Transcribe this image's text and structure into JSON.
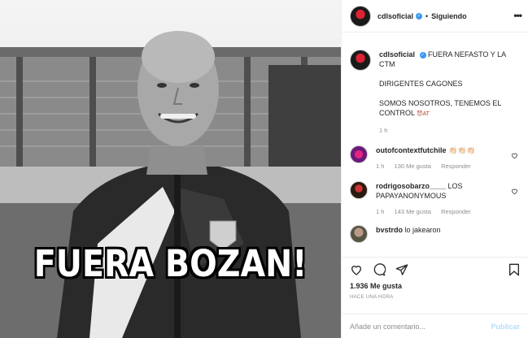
{
  "post": {
    "image_caption": "FUERA BOZAN!"
  },
  "header": {
    "username": "cdlsoficial",
    "separator": "•",
    "follow_status": "Siguiendo",
    "more": "•••"
  },
  "caption_comment": {
    "username": "cdlsoficial",
    "line1": "FUERA NEFASTO Y LA CTM",
    "line2": "DIRIGENTES CAGONES",
    "line3": "SOMOS NOSOTROS, TENEMOS EL CONTROL",
    "emoji": "😈AT",
    "time": "1 h"
  },
  "comments": [
    {
      "username": "outofcontextfutchile",
      "text": "👏🏻👏🏻👏🏻",
      "time": "1 h",
      "likes": "130 Me gusta",
      "reply": "Responder"
    },
    {
      "username": "rodrigosobarzo____",
      "text": "LOS PAPAYANONYMOUS",
      "time": "1 h",
      "likes": "143 Me gusta",
      "reply": "Responder"
    },
    {
      "username": "bvstrdo",
      "text": "lo jakearon",
      "time": "",
      "likes": "",
      "reply": ""
    }
  ],
  "actions": {
    "likes": "1.936 Me gusta",
    "posted": "HACE UNA HORA"
  },
  "compose": {
    "placeholder": "Añade un comentario...",
    "publish": "Publicar"
  }
}
